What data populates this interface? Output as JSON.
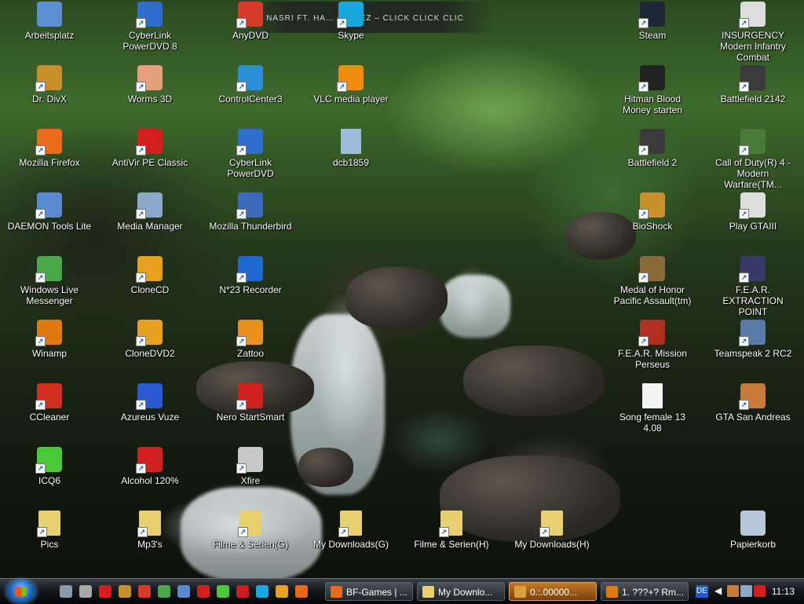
{
  "banner": "NASRI FT. HA… STYLEZ – CLICK CLICK CLIC",
  "desktop": {
    "icons": [
      {
        "label": "Arbeitsplatz",
        "icon": "computer-icon",
        "color": "#5b8fcf"
      },
      {
        "label": "CyberLink PowerDVD 8",
        "icon": "powerdvd-icon",
        "color": "#2f6ccc"
      },
      {
        "label": "AnyDVD",
        "icon": "fox-icon",
        "color": "#d63a2a"
      },
      {
        "label": "Skype",
        "icon": "skype-icon",
        "color": "#19a7e0"
      },
      {
        "label": "Steam",
        "icon": "steam-icon",
        "color": "#1d2735"
      },
      {
        "label": "INSURGENCY Modern Infantry Combat",
        "icon": "fist-icon",
        "color": "#dddddd"
      },
      {
        "label": "Dr. DivX",
        "icon": "divx-icon",
        "color": "#c7902c"
      },
      {
        "label": "Worms 3D",
        "icon": "worm-icon",
        "color": "#e3a07a"
      },
      {
        "label": "ControlCenter3",
        "icon": "controlcenter-icon",
        "color": "#2a8fd8"
      },
      {
        "label": "VLC media player",
        "icon": "vlc-cone-icon",
        "color": "#f08c10"
      },
      {
        "label": "Hitman Blood Money starten",
        "icon": "hitman-icon",
        "color": "#222222"
      },
      {
        "label": "Battlefield 2142",
        "icon": "bf2142-icon",
        "color": "#3a3a3a"
      },
      {
        "label": "Mozilla Firefox",
        "icon": "firefox-icon",
        "color": "#e86a1a"
      },
      {
        "label": "AntiVir PE Classic",
        "icon": "antivir-icon",
        "color": "#d41e1e"
      },
      {
        "label": "CyberLink PowerDVD",
        "icon": "powerdvd-icon",
        "color": "#2f6ccc"
      },
      {
        "label": "dcb1859",
        "icon": "image-file-icon",
        "color": "#9fbcd8"
      },
      {
        "label": "Battlefield 2",
        "icon": "bf2-icon",
        "color": "#3a3a3a"
      },
      {
        "label": "Call of Duty(R) 4 - Modern Warfare(TM...",
        "icon": "cod4-icon",
        "color": "#4a7a3a"
      },
      {
        "label": "DAEMON Tools Lite",
        "icon": "daemon-icon",
        "color": "#5a8ad0"
      },
      {
        "label": "Media Manager",
        "icon": "media-manager-icon",
        "color": "#8aa8c8"
      },
      {
        "label": "Mozilla Thunderbird",
        "icon": "thunderbird-icon",
        "color": "#3a6ab8"
      },
      {
        "label": "BioShock",
        "icon": "bioshock-icon",
        "color": "#c8902a"
      },
      {
        "label": "Play GTAIII",
        "icon": "gta3-icon",
        "color": "#dddddd"
      },
      {
        "label": "Windows Live Messenger",
        "icon": "messenger-icon",
        "color": "#4aa84a"
      },
      {
        "label": "CloneCD",
        "icon": "clonecd-icon",
        "color": "#e8a020"
      },
      {
        "label": "N*23 Recorder",
        "icon": "recorder-icon",
        "color": "#1e6ad0"
      },
      {
        "label": "Medal of Honor Pacific Assault(tm)",
        "icon": "moh-icon",
        "color": "#8a6a3a"
      },
      {
        "label": "F.E.A.R. EXTRACTION POINT",
        "icon": "fear-icon",
        "color": "#3a3a6a"
      },
      {
        "label": "Winamp",
        "icon": "winamp-icon",
        "color": "#e07a10"
      },
      {
        "label": "CloneDVD2",
        "icon": "clonedvd-icon",
        "color": "#e8a020"
      },
      {
        "label": "Zattoo",
        "icon": "zattoo-icon",
        "color": "#e89020"
      },
      {
        "label": "F.E.A.R. Mission Perseus",
        "icon": "fear-perseus-icon",
        "color": "#b03020"
      },
      {
        "label": "Teamspeak 2 RC2",
        "icon": "teamspeak-icon",
        "color": "#5a7aa8"
      },
      {
        "label": "CCleaner",
        "icon": "ccleaner-icon",
        "color": "#d03020"
      },
      {
        "label": "Azureus Vuze",
        "icon": "azureus-frog-icon",
        "color": "#2a5ad0"
      },
      {
        "label": "Nero StartSmart",
        "icon": "nero-icon",
        "color": "#d02020"
      },
      {
        "label": "Song female 13 4.08",
        "icon": "blank-file-icon",
        "color": "#f4f4f4"
      },
      {
        "label": "GTA San Andreas",
        "icon": "gta-sa-icon",
        "color": "#c87a3a"
      },
      {
        "label": "ICQ6",
        "icon": "icq-flower-icon",
        "color": "#4ac83a"
      },
      {
        "label": "Alcohol 120%",
        "icon": "alcohol-icon",
        "color": "#d02020"
      },
      {
        "label": "Xfire",
        "icon": "xfire-icon",
        "color": "#c8c8c8"
      },
      {
        "label": "Pics",
        "icon": "folder-icon",
        "color": "#e8d070"
      },
      {
        "label": "Mp3's",
        "icon": "folder-icon",
        "color": "#e8d070"
      },
      {
        "label": "Filme & Serien(G)",
        "icon": "folder-icon",
        "color": "#e8d070"
      },
      {
        "label": "My Downloads(G)",
        "icon": "folder-icon",
        "color": "#e8d070"
      },
      {
        "label": "Filme & Serien(H)",
        "icon": "folder-icon",
        "color": "#e8d070"
      },
      {
        "label": "My Downloads(H)",
        "icon": "folder-icon",
        "color": "#e8d070"
      },
      {
        "label": "Papierkorb",
        "icon": "recycle-bin-icon",
        "color": "#b8c8d8"
      }
    ]
  },
  "taskbar": {
    "quicklaunch": [
      {
        "icon": "ql-app-icon-1",
        "color": "#8a9aa8"
      },
      {
        "icon": "ql-app-icon-2",
        "color": "#a8a8a8"
      },
      {
        "icon": "ql-antivir-icon",
        "color": "#d41e1e"
      },
      {
        "icon": "ql-divx-icon",
        "color": "#c7902c"
      },
      {
        "icon": "ql-anydvd-icon",
        "color": "#d63a2a"
      },
      {
        "icon": "ql-messenger-icon",
        "color": "#4aa84a"
      },
      {
        "icon": "ql-app-icon-3",
        "color": "#5a8ad0"
      },
      {
        "icon": "ql-nero-icon",
        "color": "#d02020"
      },
      {
        "icon": "ql-icq-icon",
        "color": "#4ac83a"
      },
      {
        "icon": "ql-app-icon-4",
        "color": "#c82020"
      },
      {
        "icon": "ql-skype-icon",
        "color": "#19a7e0"
      },
      {
        "icon": "ql-app-icon-5",
        "color": "#e8a020"
      },
      {
        "icon": "ql-firefox-icon",
        "color": "#e86a1a"
      }
    ],
    "tasks": [
      {
        "label": "BF-Games | ...",
        "icon": "firefox-icon",
        "color": "#e86a1a",
        "active": false
      },
      {
        "label": "My Downlo...",
        "icon": "folder-icon",
        "color": "#e8d070",
        "active": false
      },
      {
        "label": "0.:.00000...",
        "icon": "app-icon",
        "color": "#d8a040",
        "active": true
      },
      {
        "label": "1. ???+? Rm...",
        "icon": "winamp-icon",
        "color": "#e07a10",
        "active": false
      }
    ],
    "language": "DE",
    "tray": [
      {
        "icon": "tray-app-icon",
        "color": "#c87a3a"
      },
      {
        "icon": "tray-recorder-icon",
        "color": "#8aa8c8"
      },
      {
        "icon": "tray-antivir-icon",
        "color": "#d41e1e"
      }
    ],
    "clock": "11:13"
  }
}
